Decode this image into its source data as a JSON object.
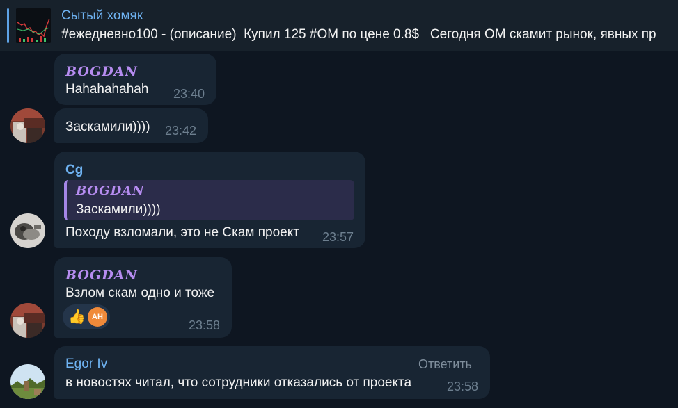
{
  "pinned": {
    "title": "Сытый хомяк",
    "text": "#ежедневно100 - (описание)  Купил 125 #OM по цене 0.8$   Сегодня OM скамит рынок, явных пр"
  },
  "messages": [
    {
      "sender": "BOGDAN",
      "text": "Hahahahahah",
      "time": "23:40"
    },
    {
      "text": "Заскамили))))",
      "time": "23:42"
    },
    {
      "sender": "Cg",
      "quote_sender": "BOGDAN",
      "quote_text": "Заскамили))))",
      "text": "Походу взломали, это не Скам проект",
      "time": "23:57"
    },
    {
      "sender": "BOGDAN",
      "text": "Взлом скам одно и тоже",
      "time": "23:58",
      "reaction_icon": "thumbs-up-icon",
      "reaction_emoji": "👍",
      "reactor_initials": "AH"
    },
    {
      "sender": "Egor Iv",
      "text": "в новостях читал, что сотрудники отказались от проекта",
      "time": "23:58",
      "reply_label": "Ответить"
    }
  ]
}
